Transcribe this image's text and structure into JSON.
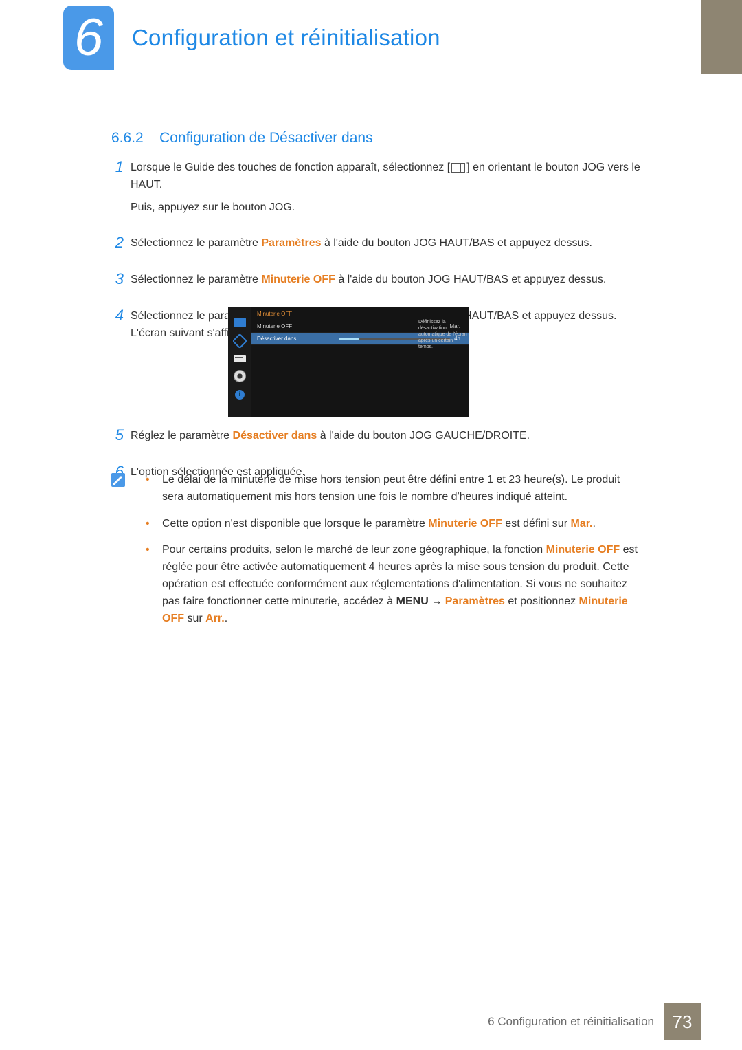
{
  "header": {
    "chapter_number": "6",
    "chapter_title": "Configuration et réinitialisation"
  },
  "section": {
    "number": "6.6.2",
    "title": "Configuration de Désactiver dans"
  },
  "steps": [
    {
      "num": "1",
      "body_parts": [
        {
          "t": "text",
          "v": "Lorsque le Guide des touches de fonction apparaît, sélectionnez ["
        },
        {
          "t": "menuicon"
        },
        {
          "t": "text",
          "v": "] en orientant le bouton JOG vers le HAUT."
        }
      ],
      "extra": "Puis, appuyez sur le bouton JOG."
    },
    {
      "num": "2",
      "body_parts": [
        {
          "t": "text",
          "v": "Sélectionnez le paramètre "
        },
        {
          "t": "emph",
          "v": "Paramètres"
        },
        {
          "t": "text",
          "v": " à l'aide du bouton JOG HAUT/BAS et appuyez dessus."
        }
      ]
    },
    {
      "num": "3",
      "body_parts": [
        {
          "t": "text",
          "v": "Sélectionnez le paramètre "
        },
        {
          "t": "emph",
          "v": "Minuterie OFF"
        },
        {
          "t": "text",
          "v": " à l'aide du bouton JOG HAUT/BAS et appuyez dessus."
        }
      ]
    },
    {
      "num": "4",
      "body_parts": [
        {
          "t": "text",
          "v": "Sélectionnez le paramètre "
        },
        {
          "t": "emph",
          "v": "Désactiver dans"
        },
        {
          "t": "text",
          "v": " à l'aide du bouton JOG HAUT/BAS et appuyez dessus. L'écran suivant s'affiche."
        }
      ]
    }
  ],
  "osd": {
    "title": "Minuterie OFF",
    "rows": [
      {
        "label": "Minuterie OFF",
        "value": "Mar.",
        "selected": false,
        "slider": false
      },
      {
        "label": "Désactiver dans",
        "value": "4h",
        "selected": true,
        "slider": true
      }
    ],
    "helper": "Définissez la désactivation automatique de l'écran après un certain temps."
  },
  "steps2": [
    {
      "num": "5",
      "body_parts": [
        {
          "t": "text",
          "v": "Réglez le paramètre "
        },
        {
          "t": "emph",
          "v": "Désactiver dans"
        },
        {
          "t": "text",
          "v": " à l'aide du bouton JOG GAUCHE/DROITE."
        }
      ]
    },
    {
      "num": "6",
      "body_parts": [
        {
          "t": "text",
          "v": "L'option sélectionnée est appliquée."
        }
      ]
    }
  ],
  "notes": [
    [
      {
        "t": "text",
        "v": "Le délai de la minuterie de mise hors tension peut être défini entre 1 et 23 heure(s). Le produit sera automatiquement mis hors tension une fois le nombre d'heures indiqué atteint."
      }
    ],
    [
      {
        "t": "text",
        "v": "Cette option n'est disponible que lorsque le paramètre "
      },
      {
        "t": "emph",
        "v": "Minuterie OFF"
      },
      {
        "t": "text",
        "v": " est défini sur "
      },
      {
        "t": "emph",
        "v": "Mar."
      },
      {
        "t": "text",
        "v": "."
      }
    ],
    [
      {
        "t": "text",
        "v": "Pour certains produits, selon le marché de leur zone géographique, la fonction "
      },
      {
        "t": "emph",
        "v": "Minuterie OFF"
      },
      {
        "t": "text",
        "v": " est réglée pour être activée automatiquement 4 heures après la mise sous tension du produit. Cette opération est effectuée conformément aux réglementations d'alimentation. Si vous ne souhaitez pas faire fonctionner cette minuterie, accédez à "
      },
      {
        "t": "bold",
        "v": "MENU"
      },
      {
        "t": "arrow"
      },
      {
        "t": "emph",
        "v": "Paramètres"
      },
      {
        "t": "text",
        "v": " et positionnez "
      },
      {
        "t": "emph",
        "v": "Minuterie OFF"
      },
      {
        "t": "text",
        "v": " sur "
      },
      {
        "t": "emph",
        "v": "Arr."
      },
      {
        "t": "text",
        "v": "."
      }
    ]
  ],
  "footer": {
    "text": "6 Configuration et réinitialisation",
    "page": "73"
  }
}
